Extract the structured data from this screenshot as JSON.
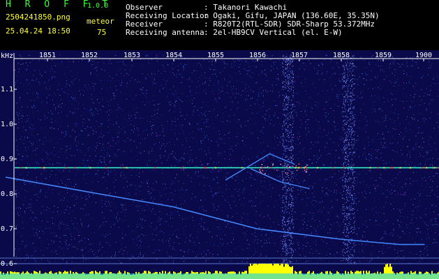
{
  "header": {
    "app_name": "H R O F F T",
    "version": "1.0.0",
    "filename": "2504241850.png",
    "datetime": "25.04.24 18:50",
    "meteor_label": "meteor",
    "meteor_count": "75"
  },
  "info": [
    {
      "label": "Observer",
      "value": ": Takanori Kawachi"
    },
    {
      "label": "Receiving Location",
      "value": ": Ogaki, Gifu, JAPAN (136.60E, 35.35N)"
    },
    {
      "label": "Receiver",
      "value": ": R820T2(RTL-SDR) SDR-Sharp 53.372MHz"
    },
    {
      "label": "Receiving antenna",
      "value": ": 2el-HB9CV Vertical (el. E-W)"
    }
  ],
  "colors": {
    "header_green": "#33ff33",
    "header_yellow": "#ffff33",
    "background": "#0a0a4a",
    "carrier": "#33ffcc",
    "trace": "#4488ff",
    "bottom_signal": "#ffff00",
    "bottom_base": "#00ccff"
  },
  "chart_data": {
    "type": "heatmap",
    "ylabel": "kHz",
    "x_ticks": [
      "1851",
      "1852",
      "1853",
      "1854",
      "1855",
      "1856",
      "1857",
      "1858",
      "1859",
      "1900"
    ],
    "y_ticks": [
      "1.1",
      "1.0",
      "0.9",
      "0.8",
      "0.7",
      "0.6"
    ],
    "ylim": [
      0.6,
      1.1
    ],
    "carrier_khz": 0.875,
    "traces": [
      {
        "kind": "long-descending",
        "points": [
          [
            1850.0,
            0.848
          ],
          [
            1852.0,
            0.805
          ],
          [
            1854.0,
            0.763
          ],
          [
            1856.0,
            0.7
          ],
          [
            1858.0,
            0.67
          ],
          [
            1859.4,
            0.655
          ],
          [
            1900.0,
            0.655
          ]
        ]
      },
      {
        "kind": "upper-echo",
        "points": [
          [
            1855.25,
            0.84
          ],
          [
            1856.3,
            0.915
          ],
          [
            1856.9,
            0.885
          ]
        ]
      },
      {
        "kind": "lower-echo",
        "points": [
          [
            1855.85,
            0.872
          ],
          [
            1856.55,
            0.835
          ],
          [
            1857.25,
            0.815
          ]
        ]
      }
    ]
  }
}
